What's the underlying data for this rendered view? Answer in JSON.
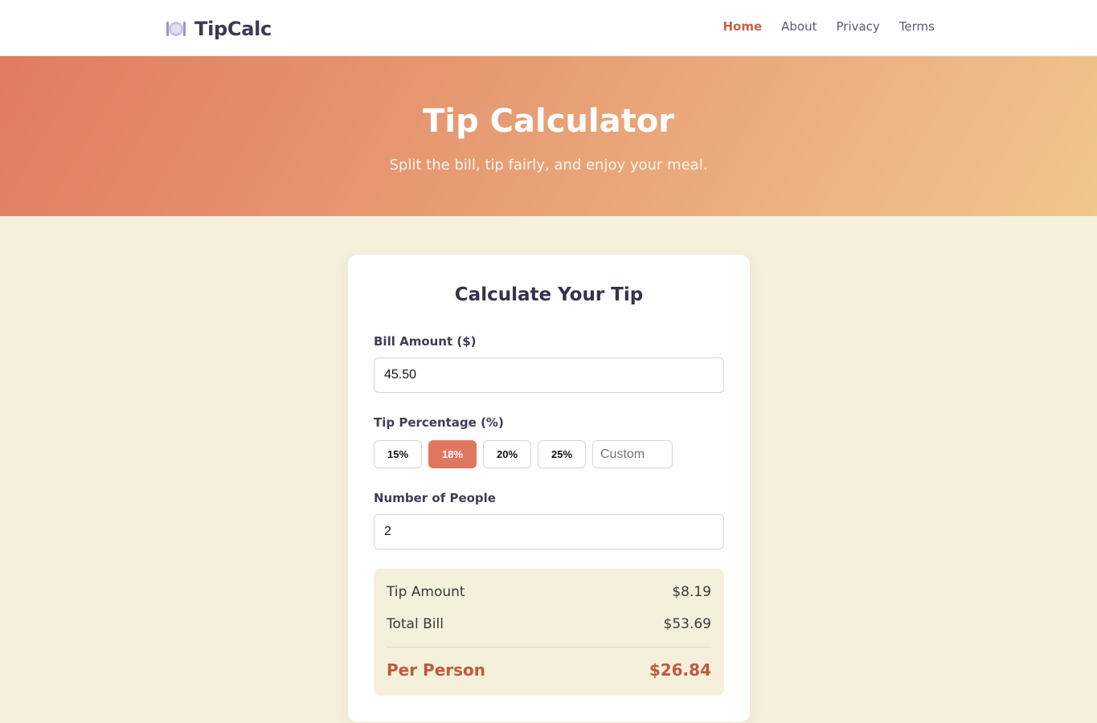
{
  "brand": {
    "name": "TipCalc",
    "icon": "plate-cutlery-icon"
  },
  "nav": {
    "items": [
      {
        "label": "Home",
        "active": true
      },
      {
        "label": "About",
        "active": false
      },
      {
        "label": "Privacy",
        "active": false
      },
      {
        "label": "Terms",
        "active": false
      }
    ]
  },
  "hero": {
    "title": "Tip Calculator",
    "subtitle": "Split the bill, tip fairly, and enjoy your meal."
  },
  "card": {
    "title": "Calculate Your Tip",
    "bill": {
      "label": "Bill Amount ($)",
      "value": "45.50"
    },
    "tip": {
      "label": "Tip Percentage (%)",
      "options": [
        "15%",
        "18%",
        "20%",
        "25%"
      ],
      "selected": "18%",
      "custom_placeholder": "Custom"
    },
    "people": {
      "label": "Number of People",
      "value": "2"
    },
    "results": {
      "tip_label": "Tip Amount",
      "tip_value": "$8.19",
      "total_label": "Total Bill",
      "total_value": "$53.69",
      "per_person_label": "Per Person",
      "per_person_value": "$26.84"
    }
  },
  "colors": {
    "accent": "#df7760",
    "accent_text": "#c0583f",
    "page_bg": "#f5f0dc",
    "hero_start": "#e07b62",
    "hero_end": "#f0c78d"
  }
}
